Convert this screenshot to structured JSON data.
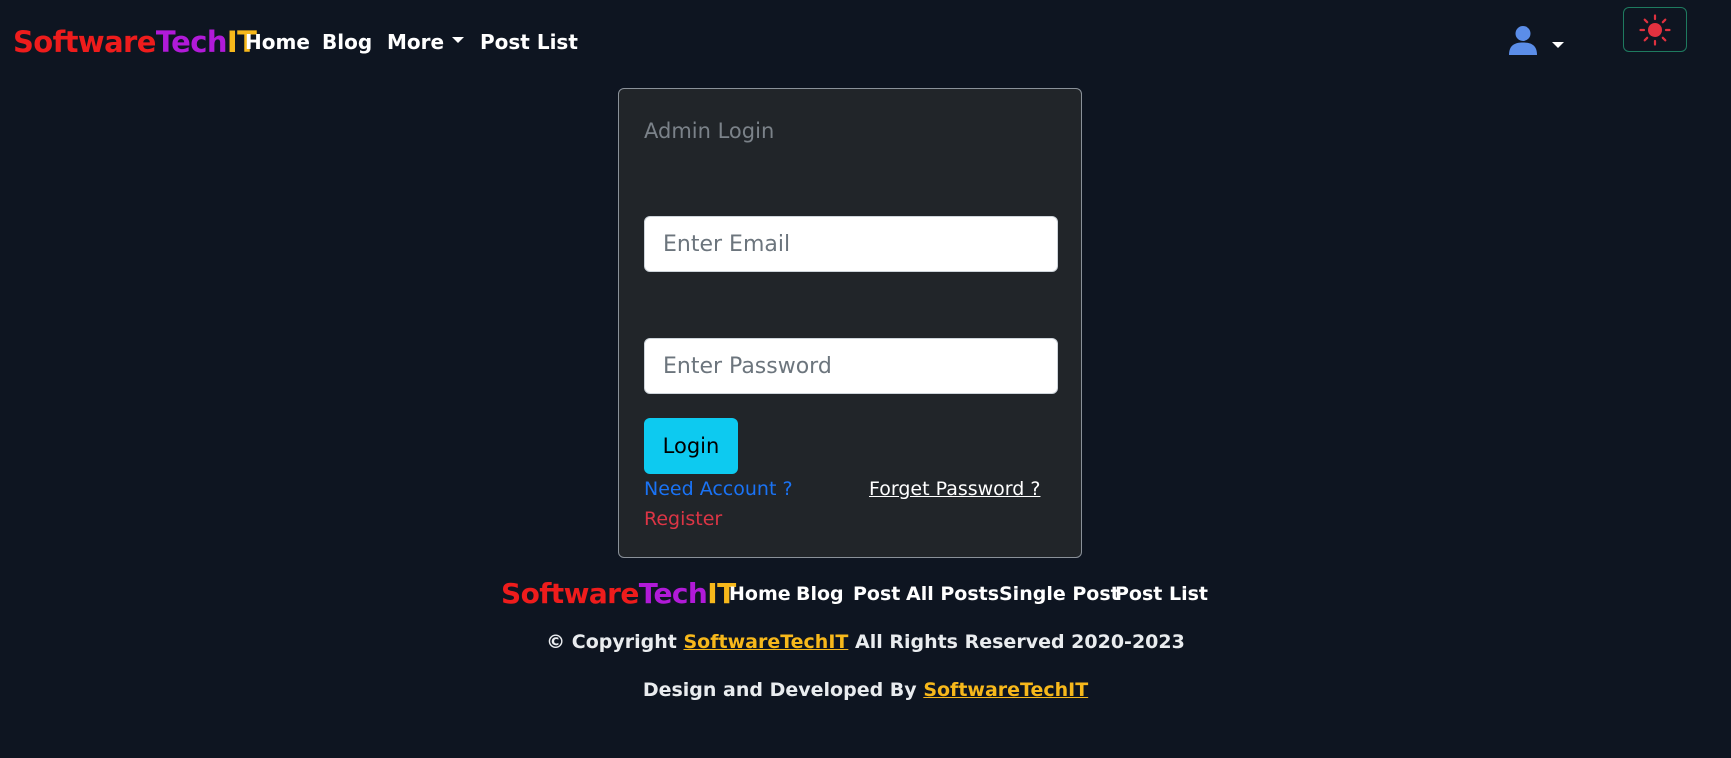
{
  "colors": {
    "background": "#0e1521",
    "brand_software": "#ee1c1c",
    "brand_tech": "#b11ad8",
    "brand_it": "#f7b81b",
    "accent_cyan": "#0dcaf0",
    "link_blue": "#1a73f5",
    "link_red": "#dc3545",
    "user_icon": "#5b8de8",
    "sun_icon": "#e0313f"
  },
  "navbar": {
    "brand": {
      "part1": "Software",
      "part2": "Tech",
      "part3": "IT"
    },
    "links": [
      "Home",
      "Blog",
      "More",
      "Post List"
    ],
    "user_icon": "user-icon",
    "theme_icon": "sun-icon"
  },
  "login": {
    "title": "Admin Login",
    "email_placeholder": "Enter Email",
    "password_placeholder": "Enter Password",
    "button": "Login",
    "need_account": "Need Account ?",
    "register": "Register",
    "forget_password": "Forget Password ?"
  },
  "footer": {
    "brand": {
      "part1": "Software",
      "part2": "Tech",
      "part3": "IT"
    },
    "links": [
      "Home",
      "Blog",
      "Post",
      "All Posts",
      "Single Post",
      "Post List"
    ],
    "copyright_prefix": "© Copyright",
    "copyright_brand": "SoftwareTechIT",
    "copyright_suffix": "All Rights Reserved 2020-2023",
    "design_prefix": "Design and Developed By",
    "design_brand": "SoftwareTechIT"
  }
}
